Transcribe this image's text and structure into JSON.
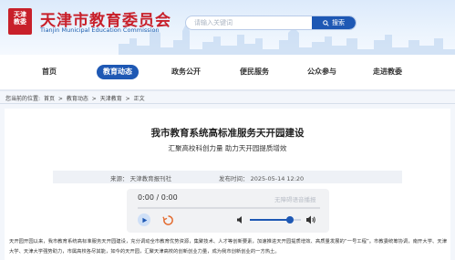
{
  "header": {
    "logo_text": [
      "天津",
      "教委"
    ],
    "site_title": "天津市教育委员会",
    "site_subtitle": "Tianjin Municipal Education Commission",
    "search": {
      "placeholder": "请输入关键词",
      "button_label": "搜索"
    }
  },
  "nav": {
    "items": [
      {
        "label": "首页",
        "active": false
      },
      {
        "label": "教育动态",
        "active": true
      },
      {
        "label": "政务公开",
        "active": false
      },
      {
        "label": "便民服务",
        "active": false
      },
      {
        "label": "公众参与",
        "active": false
      },
      {
        "label": "走进教委",
        "active": false
      }
    ]
  },
  "breadcrumb": {
    "prefix": "您当前的位置:",
    "items": [
      "首页",
      "教育动态",
      "天津教育",
      "正文"
    ],
    "separator": ">"
  },
  "article": {
    "title": "我市教育系统高标准服务天开园建设",
    "subtitle": "汇聚高校科创力量 助力天开园提质增效",
    "source_label": "来源：",
    "source": "天津教育报刊社",
    "date_label": "发布时间：",
    "date": "2025-05-14 12:20",
    "body": "天开园开园以来，我市教育系统高标准服务天开园建设，充分调动全市教育优势资源，集聚技术、人才等创新要素，加速推进天开园提质增效、高质量发展的“一号工程”。市教委统筹协调，南开大学、天津大学、天津大学强势助力，市属高校各尽其能，如今的天开园，汇聚天津高校的创新创业力量，成为我市创新创业的一方热土。"
  },
  "audio": {
    "time": "0:00 / 0:00",
    "voice_label": "无障碍语音播报",
    "volume": 0.78
  },
  "colors": {
    "brand_red": "#c8202a",
    "brand_blue": "#1e58b4"
  }
}
